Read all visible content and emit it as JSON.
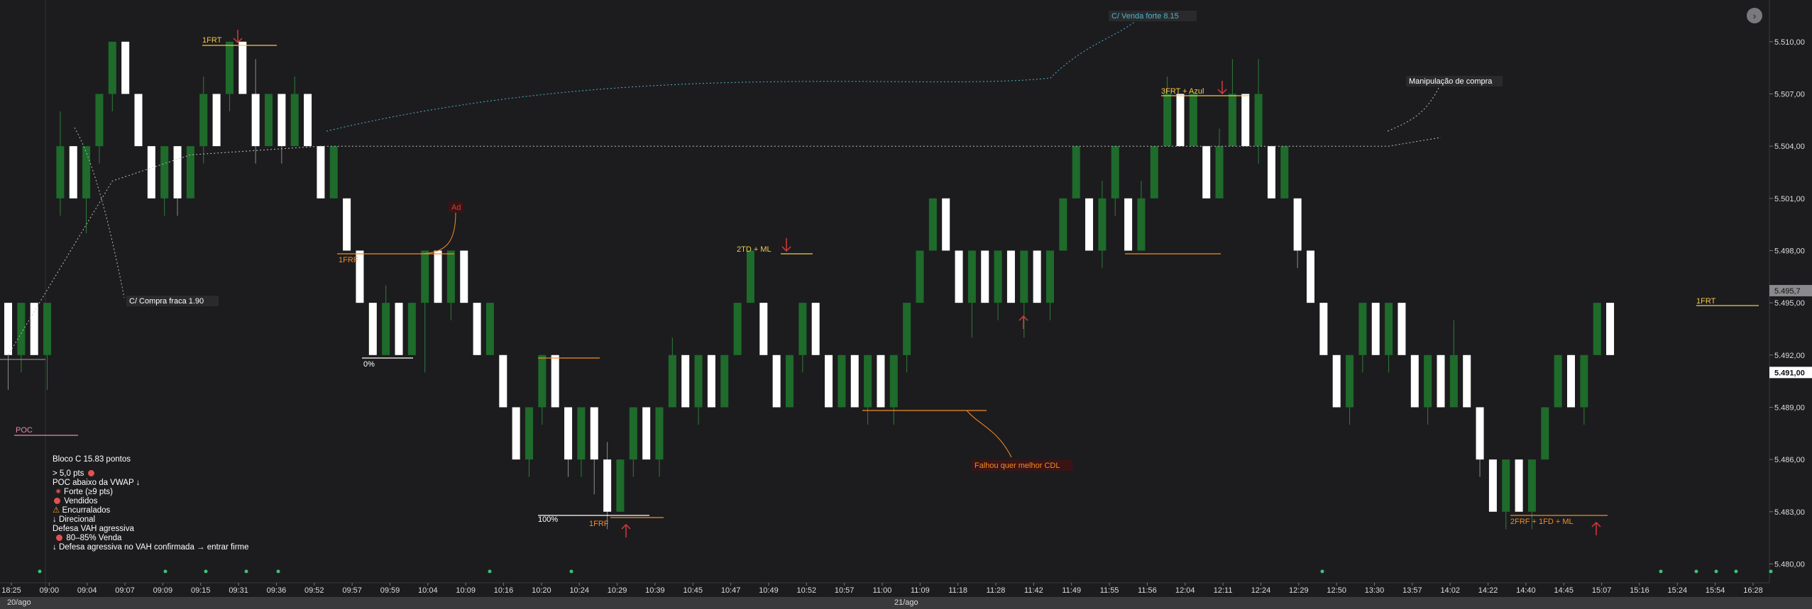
{
  "chart_data": {
    "type": "candlestick",
    "y_axis": {
      "ticks": [
        "5.510,00",
        "5.507,00",
        "5.504,00",
        "5.501,00",
        "5.498,00",
        "5.495,00",
        "5.492,00",
        "5.489,00",
        "5.486,00",
        "5.483,00",
        "5.480,00"
      ],
      "tick_values": [
        5510,
        5507,
        5504,
        5501,
        5498,
        5495,
        5492,
        5489,
        5486,
        5483,
        5480
      ],
      "range": [
        5479,
        5511.5
      ],
      "current_price_label": "5.491,00",
      "current_price": 5491,
      "vwap_label": "5.495,7",
      "vwap_value": 5495.7
    },
    "x_axis": {
      "tick_labels": [
        "18:25",
        "09:00",
        "09:04",
        "09:07",
        "09:09",
        "09:15",
        "09:31",
        "09:36",
        "09:52",
        "09:57",
        "09:59",
        "10:04",
        "10:09",
        "10:16",
        "10:20",
        "10:24",
        "10:29",
        "10:39",
        "10:45",
        "10:47",
        "10:49",
        "10:52",
        "10:57",
        "11:00",
        "11:09",
        "11:18",
        "11:28",
        "11:42",
        "11:49",
        "11:55",
        "11:56",
        "12:04",
        "12:11",
        "12:24",
        "12:29",
        "12:50",
        "13:30",
        "13:57",
        "14:02",
        "14:22",
        "14:40",
        "14:45",
        "15:07",
        "15:16",
        "15:24",
        "15:54",
        "16:28"
      ],
      "dates": [
        "20/ago",
        "21/ago"
      ]
    },
    "brick_size": 3,
    "bricks": [
      {
        "o": 5495,
        "c": 5492,
        "lo": 5490,
        "hi": 5495
      },
      {
        "o": 5492,
        "c": 5495,
        "lo": 5491,
        "hi": 5495
      },
      {
        "o": 5495,
        "c": 5492,
        "lo": 5492,
        "hi": 5495
      },
      {
        "o": 5492,
        "c": 5495,
        "lo": 5490,
        "hi": 5495
      },
      {
        "o": 5501,
        "c": 5504,
        "lo": 5500,
        "hi": 5506
      },
      {
        "o": 5504,
        "c": 5501,
        "lo": 5501,
        "hi": 5504
      },
      {
        "o": 5501,
        "c": 5504,
        "lo": 5499,
        "hi": 5504
      },
      {
        "o": 5504,
        "c": 5507,
        "lo": 5503,
        "hi": 5507
      },
      {
        "o": 5507,
        "c": 5510,
        "lo": 5506,
        "hi": 5510
      },
      {
        "o": 5510,
        "c": 5507,
        "lo": 5507,
        "hi": 5510
      },
      {
        "o": 5507,
        "c": 5504,
        "lo": 5504,
        "hi": 5507
      },
      {
        "o": 5504,
        "c": 5501,
        "lo": 5501,
        "hi": 5504
      },
      {
        "o": 5501,
        "c": 5504,
        "lo": 5500,
        "hi": 5504
      },
      {
        "o": 5504,
        "c": 5501,
        "lo": 5500,
        "hi": 5504
      },
      {
        "o": 5501,
        "c": 5504,
        "lo": 5501,
        "hi": 5504
      },
      {
        "o": 5504,
        "c": 5507,
        "lo": 5503,
        "hi": 5508
      },
      {
        "o": 5507,
        "c": 5504,
        "lo": 5504,
        "hi": 5507
      },
      {
        "o": 5507,
        "c": 5510,
        "lo": 5506,
        "hi": 5510
      },
      {
        "o": 5510,
        "c": 5507,
        "lo": 5507,
        "hi": 5510
      },
      {
        "o": 5507,
        "c": 5504,
        "lo": 5503,
        "hi": 5509
      },
      {
        "o": 5504,
        "c": 5507,
        "lo": 5504,
        "hi": 5507
      },
      {
        "o": 5507,
        "c": 5504,
        "lo": 5503,
        "hi": 5507
      },
      {
        "o": 5504,
        "c": 5507,
        "lo": 5504,
        "hi": 5508
      },
      {
        "o": 5507,
        "c": 5504,
        "lo": 5504,
        "hi": 5507
      },
      {
        "o": 5504,
        "c": 5501,
        "lo": 5501,
        "hi": 5504
      },
      {
        "o": 5501,
        "c": 5504,
        "lo": 5501,
        "hi": 5504
      },
      {
        "o": 5501,
        "c": 5498,
        "lo": 5498,
        "hi": 5501
      },
      {
        "o": 5498,
        "c": 5495,
        "lo": 5495,
        "hi": 5498
      },
      {
        "o": 5495,
        "c": 5492,
        "lo": 5492,
        "hi": 5495
      },
      {
        "o": 5492,
        "c": 5495,
        "lo": 5492,
        "hi": 5496
      },
      {
        "o": 5495,
        "c": 5492,
        "lo": 5492,
        "hi": 5495
      },
      {
        "o": 5492,
        "c": 5495,
        "lo": 5492,
        "hi": 5495
      },
      {
        "o": 5495,
        "c": 5498,
        "lo": 5491,
        "hi": 5498
      },
      {
        "o": 5498,
        "c": 5495,
        "lo": 5495,
        "hi": 5498
      },
      {
        "o": 5495,
        "c": 5498,
        "lo": 5494,
        "hi": 5498
      },
      {
        "o": 5498,
        "c": 5495,
        "lo": 5495,
        "hi": 5498
      },
      {
        "o": 5495,
        "c": 5492,
        "lo": 5492,
        "hi": 5495
      },
      {
        "o": 5492,
        "c": 5495,
        "lo": 5492,
        "hi": 5495
      },
      {
        "o": 5492,
        "c": 5489,
        "lo": 5489,
        "hi": 5492
      },
      {
        "o": 5489,
        "c": 5486,
        "lo": 5486,
        "hi": 5489
      },
      {
        "o": 5486,
        "c": 5489,
        "lo": 5485,
        "hi": 5489
      },
      {
        "o": 5489,
        "c": 5492,
        "lo": 5488,
        "hi": 5492
      },
      {
        "o": 5492,
        "c": 5489,
        "lo": 5489,
        "hi": 5492
      },
      {
        "o": 5489,
        "c": 5486,
        "lo": 5485,
        "hi": 5489
      },
      {
        "o": 5486,
        "c": 5489,
        "lo": 5485,
        "hi": 5489
      },
      {
        "o": 5489,
        "c": 5486,
        "lo": 5484,
        "hi": 5489
      },
      {
        "o": 5486,
        "c": 5483,
        "lo": 5482,
        "hi": 5487
      },
      {
        "o": 5483,
        "c": 5486,
        "lo": 5483,
        "hi": 5486
      },
      {
        "o": 5486,
        "c": 5489,
        "lo": 5485,
        "hi": 5489
      },
      {
        "o": 5489,
        "c": 5486,
        "lo": 5486,
        "hi": 5489
      },
      {
        "o": 5486,
        "c": 5489,
        "lo": 5485,
        "hi": 5489
      },
      {
        "o": 5489,
        "c": 5492,
        "lo": 5489,
        "hi": 5493
      },
      {
        "o": 5492,
        "c": 5489,
        "lo": 5489,
        "hi": 5492
      },
      {
        "o": 5489,
        "c": 5492,
        "lo": 5488,
        "hi": 5492
      },
      {
        "o": 5492,
        "c": 5489,
        "lo": 5489,
        "hi": 5492
      },
      {
        "o": 5489,
        "c": 5492,
        "lo": 5489,
        "hi": 5492
      },
      {
        "o": 5492,
        "c": 5495,
        "lo": 5492,
        "hi": 5495
      },
      {
        "o": 5495,
        "c": 5498,
        "lo": 5495,
        "hi": 5498
      },
      {
        "o": 5495,
        "c": 5492,
        "lo": 5492,
        "hi": 5495
      },
      {
        "o": 5492,
        "c": 5489,
        "lo": 5489,
        "hi": 5492
      },
      {
        "o": 5489,
        "c": 5492,
        "lo": 5489,
        "hi": 5492
      },
      {
        "o": 5492,
        "c": 5495,
        "lo": 5491,
        "hi": 5495
      },
      {
        "o": 5495,
        "c": 5492,
        "lo": 5492,
        "hi": 5495
      },
      {
        "o": 5492,
        "c": 5489,
        "lo": 5489,
        "hi": 5492
      },
      {
        "o": 5489,
        "c": 5492,
        "lo": 5489,
        "hi": 5492
      },
      {
        "o": 5492,
        "c": 5489,
        "lo": 5489,
        "hi": 5492
      },
      {
        "o": 5489,
        "c": 5492,
        "lo": 5488,
        "hi": 5492
      },
      {
        "o": 5492,
        "c": 5489,
        "lo": 5489,
        "hi": 5492
      },
      {
        "o": 5489,
        "c": 5492,
        "lo": 5488,
        "hi": 5492
      },
      {
        "o": 5492,
        "c": 5495,
        "lo": 5491,
        "hi": 5495
      },
      {
        "o": 5495,
        "c": 5498,
        "lo": 5495,
        "hi": 5498
      },
      {
        "o": 5498,
        "c": 5501,
        "lo": 5498,
        "hi": 5501
      },
      {
        "o": 5501,
        "c": 5498,
        "lo": 5498,
        "hi": 5501
      },
      {
        "o": 5498,
        "c": 5495,
        "lo": 5495,
        "hi": 5498
      },
      {
        "o": 5495,
        "c": 5498,
        "lo": 5493,
        "hi": 5498
      },
      {
        "o": 5498,
        "c": 5495,
        "lo": 5495,
        "hi": 5498
      },
      {
        "o": 5495,
        "c": 5498,
        "lo": 5494,
        "hi": 5498
      },
      {
        "o": 5498,
        "c": 5495,
        "lo": 5495,
        "hi": 5498
      },
      {
        "o": 5495,
        "c": 5498,
        "lo": 5493,
        "hi": 5498
      },
      {
        "o": 5498,
        "c": 5495,
        "lo": 5495,
        "hi": 5498
      },
      {
        "o": 5495,
        "c": 5498,
        "lo": 5494,
        "hi": 5498
      },
      {
        "o": 5498,
        "c": 5501,
        "lo": 5498,
        "hi": 5501
      },
      {
        "o": 5501,
        "c": 5504,
        "lo": 5501,
        "hi": 5504
      },
      {
        "o": 5501,
        "c": 5498,
        "lo": 5498,
        "hi": 5501
      },
      {
        "o": 5498,
        "c": 5501,
        "lo": 5497,
        "hi": 5502
      },
      {
        "o": 5501,
        "c": 5504,
        "lo": 5500,
        "hi": 5504
      },
      {
        "o": 5501,
        "c": 5498,
        "lo": 5498,
        "hi": 5501
      },
      {
        "o": 5498,
        "c": 5501,
        "lo": 5498,
        "hi": 5502
      },
      {
        "o": 5501,
        "c": 5504,
        "lo": 5501,
        "hi": 5504
      },
      {
        "o": 5504,
        "c": 5507,
        "lo": 5504,
        "hi": 5508
      },
      {
        "o": 5507,
        "c": 5504,
        "lo": 5504,
        "hi": 5507
      },
      {
        "o": 5504,
        "c": 5507,
        "lo": 5504,
        "hi": 5507
      },
      {
        "o": 5504,
        "c": 5501,
        "lo": 5501,
        "hi": 5504
      },
      {
        "o": 5501,
        "c": 5504,
        "lo": 5501,
        "hi": 5505
      },
      {
        "o": 5504,
        "c": 5507,
        "lo": 5504,
        "hi": 5509
      },
      {
        "o": 5507,
        "c": 5504,
        "lo": 5504,
        "hi": 5507
      },
      {
        "o": 5504,
        "c": 5507,
        "lo": 5503,
        "hi": 5509
      },
      {
        "o": 5504,
        "c": 5501,
        "lo": 5501,
        "hi": 5504
      },
      {
        "o": 5501,
        "c": 5504,
        "lo": 5501,
        "hi": 5504
      },
      {
        "o": 5501,
        "c": 5498,
        "lo": 5497,
        "hi": 5501
      },
      {
        "o": 5498,
        "c": 5495,
        "lo": 5495,
        "hi": 5498
      },
      {
        "o": 5495,
        "c": 5492,
        "lo": 5492,
        "hi": 5495
      },
      {
        "o": 5492,
        "c": 5489,
        "lo": 5489,
        "hi": 5492
      },
      {
        "o": 5489,
        "c": 5492,
        "lo": 5488,
        "hi": 5492
      },
      {
        "o": 5492,
        "c": 5495,
        "lo": 5491,
        "hi": 5495
      },
      {
        "o": 5495,
        "c": 5492,
        "lo": 5492,
        "hi": 5495
      },
      {
        "o": 5492,
        "c": 5495,
        "lo": 5491,
        "hi": 5495
      },
      {
        "o": 5495,
        "c": 5492,
        "lo": 5492,
        "hi": 5495
      },
      {
        "o": 5492,
        "c": 5489,
        "lo": 5489,
        "hi": 5492
      },
      {
        "o": 5489,
        "c": 5492,
        "lo": 5488,
        "hi": 5492
      },
      {
        "o": 5492,
        "c": 5489,
        "lo": 5489,
        "hi": 5492
      },
      {
        "o": 5489,
        "c": 5492,
        "lo": 5489,
        "hi": 5494
      },
      {
        "o": 5492,
        "c": 5489,
        "lo": 5489,
        "hi": 5492
      },
      {
        "o": 5489,
        "c": 5486,
        "lo": 5485,
        "hi": 5489
      },
      {
        "o": 5486,
        "c": 5483,
        "lo": 5483,
        "hi": 5486
      },
      {
        "o": 5483,
        "c": 5486,
        "lo": 5482,
        "hi": 5486
      },
      {
        "o": 5486,
        "c": 5483,
        "lo": 5483,
        "hi": 5486
      },
      {
        "o": 5483,
        "c": 5486,
        "lo": 5482,
        "hi": 5486
      },
      {
        "o": 5486,
        "c": 5489,
        "lo": 5486,
        "hi": 5489
      },
      {
        "o": 5489,
        "c": 5492,
        "lo": 5489,
        "hi": 5492
      },
      {
        "o": 5492,
        "c": 5489,
        "lo": 5489,
        "hi": 5492
      },
      {
        "o": 5489,
        "c": 5492,
        "lo": 5488,
        "hi": 5492
      },
      {
        "o": 5492,
        "c": 5495,
        "lo": 5492,
        "hi": 5495
      },
      {
        "o": 5495,
        "c": 5492,
        "lo": 5492,
        "hi": 5495
      }
    ],
    "vwap": [
      [
        0,
        5492
      ],
      [
        8,
        5502
      ],
      [
        14,
        5503.5
      ],
      [
        24,
        5504
      ],
      [
        40,
        5504
      ],
      [
        60,
        5504
      ],
      [
        80,
        5504
      ],
      [
        96,
        5504
      ],
      [
        106,
        5504
      ],
      [
        110,
        5504.5
      ]
    ],
    "poc_label": "POC",
    "poc_value": 5486.2
  },
  "annotations": {
    "compra_fraca": "C/ Compra fraca 1.90",
    "venda_forte": "C/ Venda forte 8.15",
    "manipulacao": "Manipulação de compra",
    "frt1": "1FRT",
    "frf1": "1FRF",
    "ad": "Ad",
    "zero_pct": "0%",
    "hundred_pct": "100%",
    "frf1b": "1FRF",
    "td_ml": "2TD + ML",
    "falhou": "Falhou quer melhor CDL",
    "frt3": "3FRT + Azul",
    "frf2": "2FRF  + 1FD + ML",
    "frt1b": "1FRT"
  },
  "info": {
    "title": "Bloco C  15.83 pontos",
    "lines": [
      "> 5,0 pts",
      "POC abaixo da VWAP ↓",
      "Forte (≥9 pts)",
      "Vendidos",
      "Encurralados",
      "↓ Direcional",
      "Defesa VAH agressiva",
      "80–85% Venda",
      "↓ Defesa agressiva no VAH confirmada → entrar firme"
    ]
  },
  "colors": {
    "background": "#1c1c1e",
    "bull": "#1e6b2b",
    "bear": "#ffffff",
    "vwap": "#bfbfbf",
    "venda": "#4fb3c9",
    "orange": "#f28c28",
    "red": "#d63a3a",
    "green_dot": "#3ec07a"
  }
}
